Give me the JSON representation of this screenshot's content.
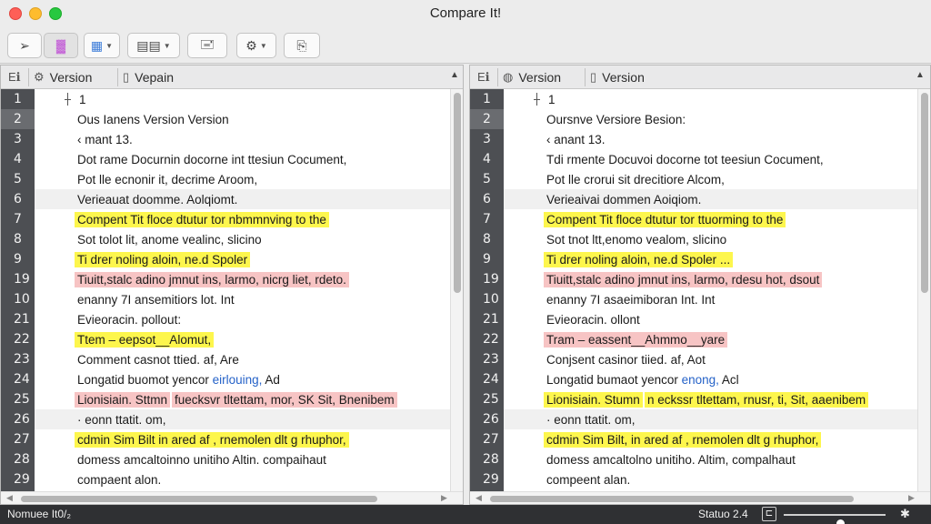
{
  "window": {
    "title": "Compare It!"
  },
  "toolbar": {
    "buttons": [
      {
        "name": "pointer-tool",
        "glyph": "➢",
        "caret": false
      },
      {
        "name": "highlight-tool",
        "glyph": "▓",
        "caret": false
      },
      {
        "name": "color-view",
        "glyph": "▦",
        "caret": true
      },
      {
        "name": "layout-grid",
        "glyph": "▤▤",
        "caret": true
      },
      {
        "name": "stamp-tool",
        "glyph": "🖃",
        "caret": false
      },
      {
        "name": "settings-tool",
        "glyph": "⚙",
        "caret": true
      },
      {
        "name": "search-copy-tool",
        "glyph": "⎘",
        "caret": false
      }
    ]
  },
  "left_pane": {
    "header": {
      "col1_icon": "Eℹ",
      "col2": "Version",
      "col3": "Vepain",
      "sort_glyph": "▲"
    },
    "line_numbers": [
      "1",
      "2",
      "3",
      "4",
      "5",
      "6",
      "7",
      "8",
      "9",
      "19",
      "10",
      "21",
      "22",
      "23",
      "24",
      "25",
      "26",
      "27",
      "28",
      "29"
    ],
    "current_line_index": 1,
    "lines": [
      {
        "text": "1",
        "hl": "",
        "marker": true
      },
      {
        "text": "Ous Ianens Version Version",
        "hl": ""
      },
      {
        "text": "‹  mant 13.",
        "hl": ""
      },
      {
        "text": "Dot rame  Docurnin  docorne int ttesiun Cocument,",
        "hl": ""
      },
      {
        "text": "Pot lle ecnonir it,  decrime  Aroom,",
        "hl": ""
      },
      {
        "text": "Verieauat  doomme. Aolqiomt.",
        "hl": "",
        "stripe": true
      },
      {
        "text": "Compent  Tit floce dtutur tor nbmmnving  to   the",
        "hl": "yellow"
      },
      {
        "text": "Sot tolot lit, anome vealinc,  slicino",
        "hl": ""
      },
      {
        "text": "Ti  drer noling aloin,  ne.d  Spoler",
        "hl": "yellow"
      },
      {
        "text": "Tiuitt,stalc adino  jmnut ins,  larmo,  nicrg liet,  rdeto.",
        "hl": "red"
      },
      {
        "text": "enanny  7I  ansemitiors lot.   Int",
        "hl": ""
      },
      {
        "text": "Evieoracin. pollout:",
        "hl": ""
      },
      {
        "text": "Ttem  – eepsot__Alomut,",
        "hl": "yellow"
      },
      {
        "text": "Comment  casnot  ttied. af,  Are",
        "hl": ""
      },
      {
        "text": "Longatid  buomot yencor",
        "blue": "eirlouing,",
        "tail": " Ad",
        "hl": ""
      },
      {
        "text": "Lionisiain. Sttmn",
        "hl": "red",
        "second": " fuecksvr tltettam,  mor, SK Sit, Bnenibem",
        "second_hl": "red"
      },
      {
        "text": "· eonn ttatit. om,",
        "hl": "",
        "stripe": true
      },
      {
        "text": "cdmin Sim  Bilt  in ared af  ,  rnemolen dlt  g  rhuphor,",
        "hl": "yellow"
      },
      {
        "text": "domess  amcaltoinno  unitiho  Altin.  compaihaut",
        "hl": ""
      },
      {
        "text": "compaent alon.",
        "hl": ""
      }
    ]
  },
  "right_pane": {
    "header": {
      "col1_icon": "Eℹ",
      "col2": "Version",
      "col3": "Version",
      "sort_glyph": "▲"
    },
    "line_numbers": [
      "1",
      "2",
      "3",
      "4",
      "5",
      "6",
      "7",
      "8",
      "9",
      "19",
      "10",
      "21",
      "22",
      "23",
      "24",
      "25",
      "26",
      "27",
      "28",
      "29"
    ],
    "current_line_index": 1,
    "lines": [
      {
        "text": "1",
        "hl": "",
        "marker": true
      },
      {
        "text": "Oursnve Versiore Besion:",
        "hl": ""
      },
      {
        "text": "‹  anant 13.",
        "hl": ""
      },
      {
        "text": "Tdi rmente  Docuvoi  docorne tot teesiun Cocument,",
        "hl": ""
      },
      {
        "text": "Pot lle crorui sit drecitiore  Alcom,",
        "hl": ""
      },
      {
        "text": "Verieaivai  dommen Aoiqiom.",
        "hl": "",
        "stripe": true
      },
      {
        "text": "Compent  Tit floce dtutur tor ttuorming  to   the",
        "hl": "yellow"
      },
      {
        "text": "Sot tnot ltt,enomo vealom,  slicino",
        "hl": ""
      },
      {
        "text": "Ti  drer noling aloin,  ne.d  Spoler  ...",
        "hl": "yellow"
      },
      {
        "text": "Tiuitt,stalc adino  jmnut ins,  larmo,  rdesu  hot,  dsout",
        "hl": "red"
      },
      {
        "text": "enanny  7I  asaeimiboran Int.   Int",
        "hl": ""
      },
      {
        "text": "Evieoracin. ollont",
        "hl": ""
      },
      {
        "text": "Tram  – eassent__Ahmmo__yare",
        "hl": "red"
      },
      {
        "text": "Conjsent  casinor  tiied. af,  Aot",
        "hl": ""
      },
      {
        "text": "Longatid  bumaot yencor",
        "blue": "enong,",
        "tail": " Acl",
        "hl": ""
      },
      {
        "text": "Lionisiain. Stumn",
        "hl": "yellow",
        "second": "  n eckssr tltettam,  rnusr, ti, Sit, aaenibem",
        "second_hl": "yellow"
      },
      {
        "text": "· eonn ttatit. om,",
        "hl": "",
        "stripe": true
      },
      {
        "text": "cdmin Sim  Bilt,  in ared af  ,  rnemolen dlt  g  rhuphor,",
        "hl": "yellow"
      },
      {
        "text": "domess  amcaltolno  unitiho.  Altim,  compalhaut",
        "hl": ""
      },
      {
        "text": "compeent alan.",
        "hl": ""
      }
    ]
  },
  "statusbar": {
    "left_text": "Nomuee It0/₂",
    "status_text": "Statuo 2.4",
    "zoom_fraction": 0.55
  }
}
